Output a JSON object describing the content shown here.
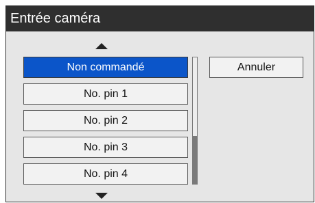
{
  "dialog": {
    "title": "Entrée caméra"
  },
  "list": {
    "items": [
      {
        "label": "Non commandé",
        "selected": true
      },
      {
        "label": "No. pin 1",
        "selected": false
      },
      {
        "label": "No. pin 2",
        "selected": false
      },
      {
        "label": "No. pin 3",
        "selected": false
      },
      {
        "label": "No. pin 4",
        "selected": false
      }
    ]
  },
  "buttons": {
    "cancel_label": "Annuler"
  },
  "icons": {
    "scroll_up": "triangle-up-icon",
    "scroll_down": "triangle-down-icon"
  },
  "colors": {
    "titlebar": "#2f2f2f",
    "selected": "#0b55c9",
    "background": "#e6e6e6"
  }
}
